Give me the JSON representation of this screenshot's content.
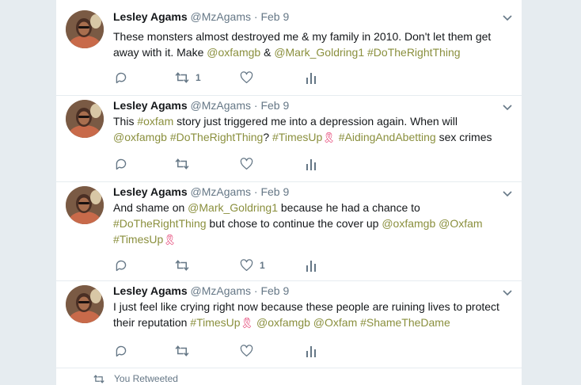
{
  "tweets": [
    {
      "name": "Lesley Agams",
      "handle": "@MzAgams",
      "time": "Feb 9",
      "text": [
        {
          "t": "These monsters almost destroyed me & my family in 2010. Don't let them get away with it. Make "
        },
        {
          "t": "@oxfamgb",
          "link": true
        },
        {
          "t": " & "
        },
        {
          "t": "@Mark_Goldring1",
          "link": true
        },
        {
          "t": " "
        },
        {
          "t": "#DoTheRightThing",
          "link": true
        }
      ],
      "reply_count": "",
      "retweet_count": "1",
      "like_count": ""
    },
    {
      "name": "Lesley Agams",
      "handle": "@MzAgams",
      "time": "Feb 9",
      "text": [
        {
          "t": "This "
        },
        {
          "t": "#oxfam",
          "link": true
        },
        {
          "t": " story just triggered me into a depression again. When will "
        },
        {
          "t": "@oxfamgb",
          "link": true
        },
        {
          "t": "  "
        },
        {
          "t": "#DoTheRightThing",
          "link": true
        },
        {
          "t": "? "
        },
        {
          "t": "#TimesUp",
          "link": true
        },
        {
          "t": "🎗",
          "emoji": true
        },
        {
          "t": " "
        },
        {
          "t": "#AidingAndAbetting",
          "link": true
        },
        {
          "t": " sex crimes"
        }
      ],
      "reply_count": "",
      "retweet_count": "",
      "like_count": ""
    },
    {
      "name": "Lesley Agams",
      "handle": "@MzAgams",
      "time": "Feb 9",
      "text": [
        {
          "t": "And shame on "
        },
        {
          "t": "@Mark_Goldring1",
          "link": true
        },
        {
          "t": " because he had a chance to "
        },
        {
          "t": "#DoTheRightThing",
          "link": true
        },
        {
          "t": " but chose to continue the cover up "
        },
        {
          "t": "@oxfamgb",
          "link": true
        },
        {
          "t": " "
        },
        {
          "t": "@Oxfam",
          "link": true
        },
        {
          "t": " "
        },
        {
          "t": "#TimesUp",
          "link": true
        },
        {
          "t": "🎗",
          "emoji": true
        }
      ],
      "reply_count": "",
      "retweet_count": "",
      "like_count": "1"
    },
    {
      "name": "Lesley Agams",
      "handle": "@MzAgams",
      "time": "Feb 9",
      "text": [
        {
          "t": "I just feel like crying right now because these people are ruining lives to protect their reputation "
        },
        {
          "t": "#TimesUp",
          "link": true
        },
        {
          "t": "🎗",
          "emoji": true
        },
        {
          "t": " "
        },
        {
          "t": "@oxfamgb",
          "link": true
        },
        {
          "t": " "
        },
        {
          "t": "@Oxfam",
          "link": true
        },
        {
          "t": " "
        },
        {
          "t": "#ShameTheDame",
          "link": true
        }
      ],
      "reply_count": "",
      "retweet_count": "",
      "like_count": ""
    }
  ],
  "retweeted_label": "You Retweeted",
  "colors": {
    "link": "#8a8f3d",
    "muted": "#657786",
    "background": "#e6ecf0"
  },
  "icons": [
    "reply-icon",
    "retweet-icon",
    "like-icon",
    "analytics-icon",
    "chevron-down-icon"
  ]
}
